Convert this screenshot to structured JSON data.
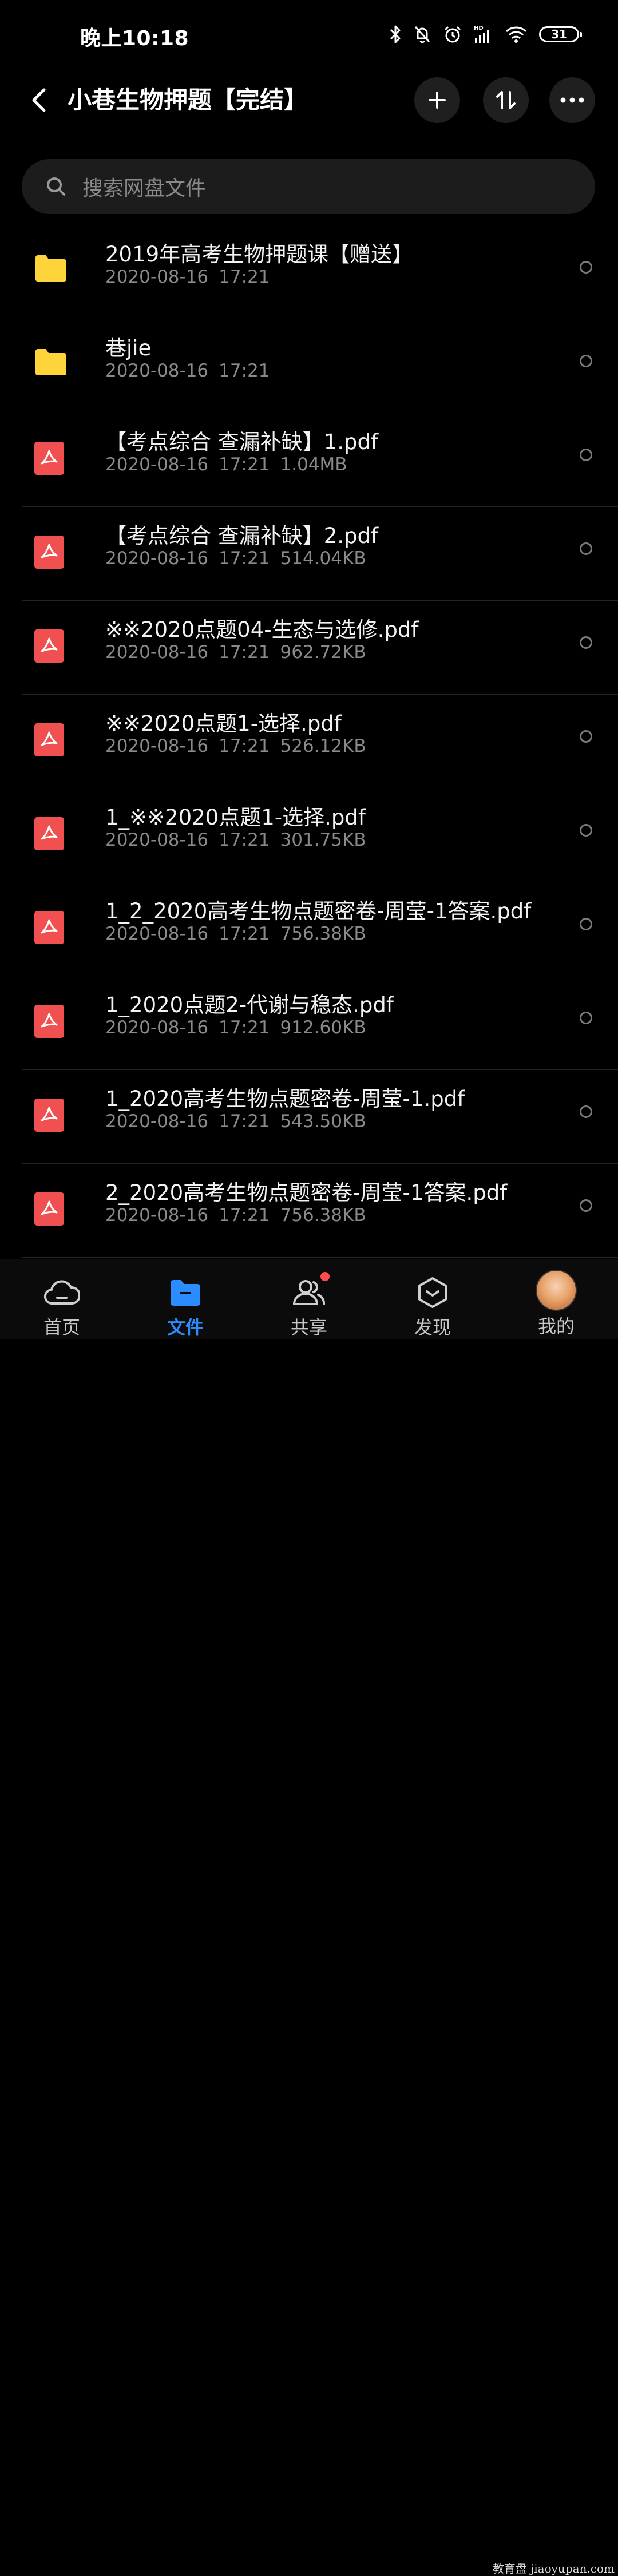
{
  "status_bar": {
    "time": "晚上10:18",
    "battery": "31",
    "icons": [
      "bluetooth-icon",
      "mute-bell-icon",
      "alarm-icon",
      "signal-hd-icon",
      "wifi-icon",
      "battery-icon"
    ]
  },
  "header": {
    "title": "小巷生物押题【完结】",
    "back_icon": "chevron-left-icon",
    "actions": [
      "add-icon",
      "sort-icon",
      "more-icon"
    ]
  },
  "search": {
    "placeholder": "搜索网盘文件"
  },
  "files": [
    {
      "type": "folder",
      "name": "2019年高考生物押题课【赠送】",
      "date": "2020-08-16",
      "time": "17:21",
      "size": ""
    },
    {
      "type": "folder",
      "name": "巷jie",
      "date": "2020-08-16",
      "time": "17:21",
      "size": ""
    },
    {
      "type": "pdf",
      "name": "【考点综合 查漏补缺】1.pdf",
      "date": "2020-08-16",
      "time": "17:21",
      "size": "1.04MB"
    },
    {
      "type": "pdf",
      "name": "【考点综合 查漏补缺】2.pdf",
      "date": "2020-08-16",
      "time": "17:21",
      "size": "514.04KB"
    },
    {
      "type": "pdf",
      "name": "※※2020点题04-生态与选修.pdf",
      "date": "2020-08-16",
      "time": "17:21",
      "size": "962.72KB"
    },
    {
      "type": "pdf",
      "name": "※※2020点题1-选择.pdf",
      "date": "2020-08-16",
      "time": "17:21",
      "size": "526.12KB"
    },
    {
      "type": "pdf",
      "name": "1_※※2020点题1-选择.pdf",
      "date": "2020-08-16",
      "time": "17:21",
      "size": "301.75KB"
    },
    {
      "type": "pdf",
      "name": "1_2_2020高考生物点题密卷-周莹-1答案.pdf",
      "date": "2020-08-16",
      "time": "17:21",
      "size": "756.38KB"
    },
    {
      "type": "pdf",
      "name": "1_2020点题2-代谢与稳态.pdf",
      "date": "2020-08-16",
      "time": "17:21",
      "size": "912.60KB"
    },
    {
      "type": "pdf",
      "name": "1_2020高考生物点题密卷-周莹-1.pdf",
      "date": "2020-08-16",
      "time": "17:21",
      "size": "543.50KB"
    },
    {
      "type": "pdf",
      "name": "2_2020高考生物点题密卷-周莹-1答案.pdf",
      "date": "2020-08-16",
      "time": "17:21",
      "size": "756.38KB"
    }
  ],
  "nav": [
    {
      "label": "首页",
      "icon": "cloud-home-icon",
      "active": false
    },
    {
      "label": "文件",
      "icon": "folder-icon",
      "active": true
    },
    {
      "label": "共享",
      "icon": "users-icon",
      "active": false,
      "badge": true
    },
    {
      "label": "发现",
      "icon": "discover-icon",
      "active": false
    },
    {
      "label": "我的",
      "icon": "avatar",
      "active": false
    }
  ],
  "watermark": "教育盘 jiaoyupan.com",
  "colors": {
    "folder": "#FFD43B",
    "pdf": "#F0504F",
    "accent": "#2B8CFF",
    "badge": "#FF4B4B"
  }
}
